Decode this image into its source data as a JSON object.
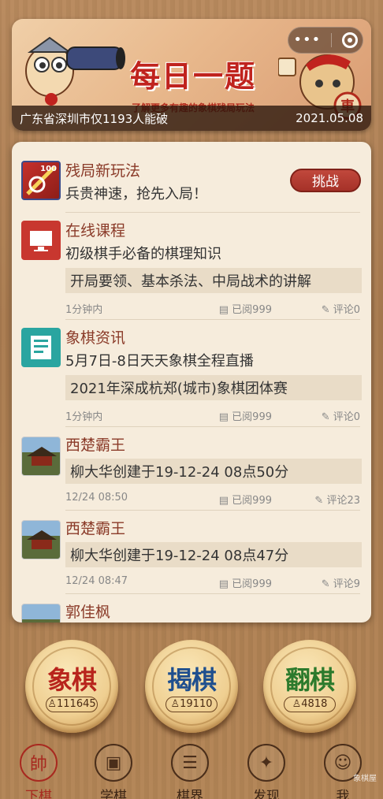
{
  "banner": {
    "title": "每日一题",
    "subtitle": "了解更多有趣的象棋残局玩法",
    "caption": "广东省深圳市仅1193人能破",
    "date": "2021.05.08",
    "badge_char": "車"
  },
  "capsule": {
    "menu_icon": "more-dots-icon",
    "close_icon": "miniprogram-close-icon"
  },
  "feed": {
    "items": [
      {
        "title": "残局新玩法",
        "line": "兵贵神速，抢先入局！",
        "action": "挑战",
        "icon": "endgame-icon",
        "thumb_text": "100"
      },
      {
        "title": "在线课程",
        "line": "初级棋手必备的棋理知识",
        "box": "开局要领、基本杀法、中局战术的讲解",
        "time": "1分钟内",
        "read": "已阅999",
        "comments": "评论0",
        "icon": "monitor-icon"
      },
      {
        "title": "象棋资讯",
        "line": "5月7日-8日天天象棋全程直播",
        "box": "2021年深成杭郑(城市)象棋团体赛",
        "time": "1分钟内",
        "read": "已阅999",
        "comments": "评论0",
        "icon": "news-icon"
      },
      {
        "title": "西楚霸王",
        "box": "柳大华创建于19-12-24 08点50分",
        "time": "12/24 08:50",
        "read": "已阅999",
        "comments": "评论23",
        "icon": "palace-avatar"
      },
      {
        "title": "西楚霸王",
        "box": "柳大华创建于19-12-24 08点47分",
        "time": "12/24 08:47",
        "read": "已阅999",
        "comments": "评论9",
        "icon": "palace-avatar"
      },
      {
        "title": "郭佳枫",
        "icon": "palace-avatar"
      }
    ]
  },
  "modes": [
    {
      "label": "象棋",
      "count": "111645",
      "color": "#b8241c"
    },
    {
      "label": "揭棋",
      "count": "19110",
      "color": "#1f4f8e"
    },
    {
      "label": "翻棋",
      "count": "4818",
      "color": "#2c7a2c"
    }
  ],
  "nav": [
    {
      "label": "下棋",
      "glyph": "帥",
      "active": true
    },
    {
      "label": "学棋",
      "glyph": "▣"
    },
    {
      "label": "棋界",
      "glyph": "☰"
    },
    {
      "label": "发现",
      "glyph": "✦"
    },
    {
      "label": "我",
      "glyph": "☺"
    }
  ],
  "watermark": "象棋屋"
}
